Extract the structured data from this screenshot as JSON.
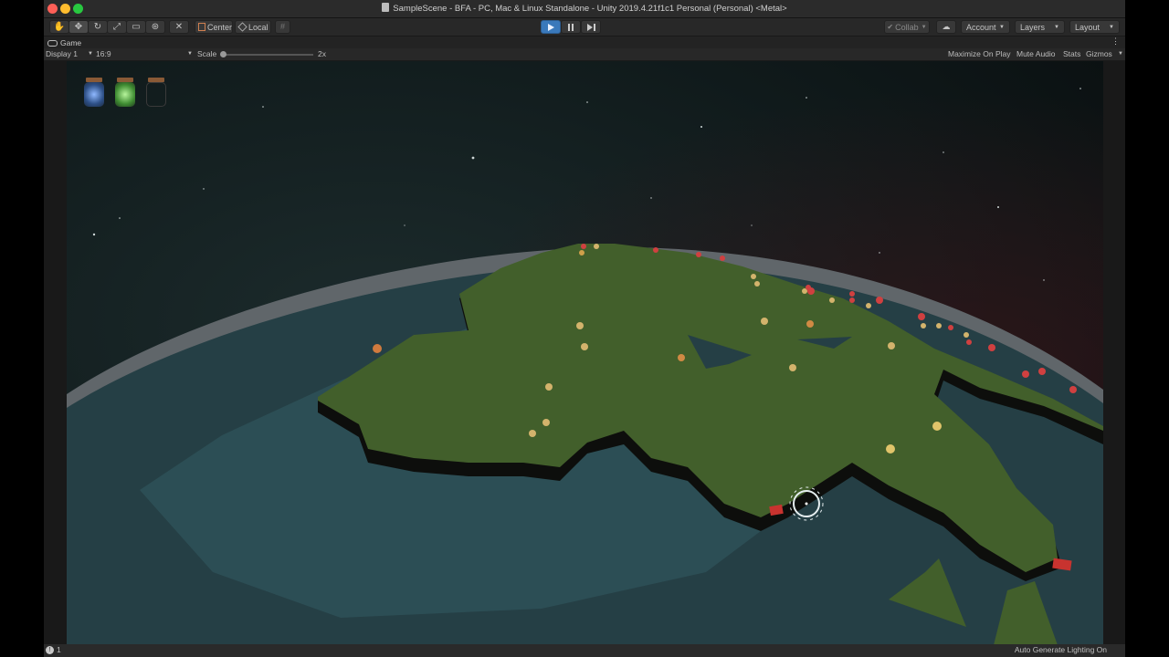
{
  "window": {
    "title": "SampleScene - BFA - PC, Mac & Linux Standalone - Unity 2019.4.21f1c1 Personal (Personal) <Metal>",
    "traffic_lights": {
      "close": "#fe5f57",
      "minimize": "#febc2e",
      "zoom": "#28c840"
    }
  },
  "toolbar": {
    "tools": [
      {
        "name": "hand-tool",
        "icon": "✋"
      },
      {
        "name": "move-tool",
        "icon": "✥"
      },
      {
        "name": "rotate-tool",
        "icon": "↻"
      },
      {
        "name": "scale-tool",
        "icon": "⤢"
      },
      {
        "name": "rect-tool",
        "icon": "▭"
      },
      {
        "name": "transform-tool",
        "icon": "⊛"
      },
      {
        "name": "custom-tool",
        "icon": "✕"
      }
    ],
    "pivot_label": "Center",
    "space_label": "Local",
    "collab_label": "Collab",
    "account_label": "Account",
    "layers_label": "Layers",
    "layout_label": "Layout",
    "play_accent": "#3a79bb"
  },
  "game_tab": {
    "label": "Game",
    "display_label": "Display 1",
    "aspect_label": "16:9",
    "scale_label": "Scale",
    "scale_value": "2x",
    "maximize_label": "Maximize On Play",
    "mute_label": "Mute Audio",
    "stats_label": "Stats",
    "gizmos_label": "Gizmos"
  },
  "hud": {
    "jars": [
      {
        "name": "blue-jar",
        "color": "#8fb8ff"
      },
      {
        "name": "green-jar",
        "color": "#7fe07a"
      },
      {
        "name": "empty-jar",
        "color": "#3a3a3a"
      }
    ]
  },
  "statusbar": {
    "count": "1",
    "lighting_label": "Auto Generate Lighting On"
  }
}
